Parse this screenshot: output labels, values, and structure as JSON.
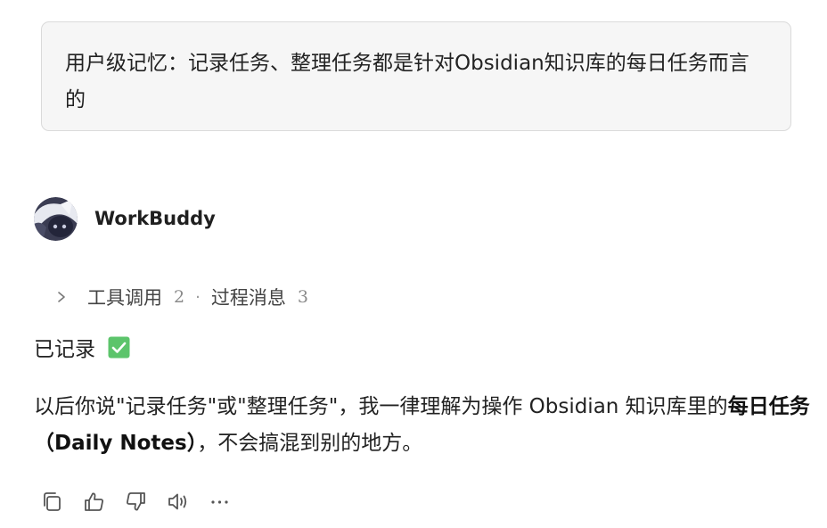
{
  "user_message": {
    "text": "用户级记忆：记录任务、整理任务都是针对Obsidian知识库的每日任务而言的"
  },
  "assistant": {
    "name": "WorkBuddy",
    "avatar_icon": "robot-avatar-icon"
  },
  "process": {
    "tool_calls_label": "工具调用",
    "tool_calls_count": "2",
    "separator": "·",
    "process_messages_label": "过程消息",
    "process_messages_count": "3"
  },
  "reply": {
    "status_text": "已记录",
    "status_icon": "check-mark-button-emoji",
    "paragraph_part1": "以后你说\"记录任务\"或\"整理任务\"，我一律理解为操作 Obsidian 知识库里的",
    "paragraph_bold": "每日任务（Daily Notes）",
    "paragraph_part2": "，不会搞混到别的地方。"
  },
  "actions": [
    {
      "name": "copy",
      "icon": "copy-icon"
    },
    {
      "name": "like",
      "icon": "thumbs-up-icon"
    },
    {
      "name": "dislike",
      "icon": "thumbs-down-icon"
    },
    {
      "name": "read-aloud",
      "icon": "speaker-icon"
    },
    {
      "name": "more",
      "icon": "more-icon"
    }
  ],
  "colors": {
    "bubble_bg": "#f6f6f6",
    "bubble_border": "#dadada",
    "check_green": "#5cc46b",
    "icon_gray": "#555555"
  }
}
